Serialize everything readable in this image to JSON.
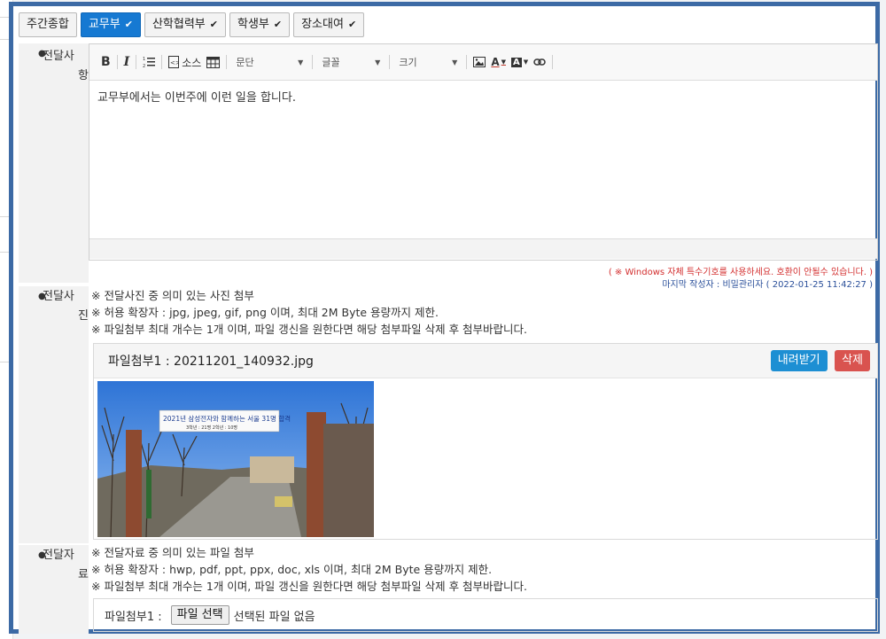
{
  "tabs": [
    {
      "label": "주간종합",
      "check": false,
      "active": false
    },
    {
      "label": "교무부",
      "check": true,
      "active": true
    },
    {
      "label": "산학협력부",
      "check": true,
      "active": false
    },
    {
      "label": "학생부",
      "check": true,
      "active": false
    },
    {
      "label": "장소대여",
      "check": true,
      "active": false
    }
  ],
  "check_glyph": "✔",
  "fields": {
    "message": {
      "label_a": "전달사",
      "label_b": "항"
    },
    "photo": {
      "label_a": "전달사",
      "label_b": "진"
    },
    "file": {
      "label_a": "전달자",
      "label_b": "료"
    }
  },
  "editor": {
    "toolbar": {
      "bold": "B",
      "italic": "I",
      "source": "소스",
      "paragraph": "문단",
      "font": "글꼴",
      "size": "크기",
      "text_color": "A",
      "bg_color": "A"
    },
    "content": "교무부에서는 이번주에 이런 일을 합니다."
  },
  "notes": {
    "warning": "( ※ Windows 자체 특수기호를 사용하세요. 호환이 안될수 있습니다. )",
    "last_author": "마지막 작성자 : 비밀관리자 ( 2022-01-25 11:42:27 )"
  },
  "photo_hints": [
    "※ 전달사진 중 의미 있는 사진 첨부",
    "※ 허용 확장자 : jpg, jpeg, gif, png 이며, 최대 2M Byte 용량까지 제한.",
    "※ 파일첨부 최대 개수는 1개 이며, 파일 갱신을 원한다면 해당 첨부파일 삭제 후 첨부바랍니다."
  ],
  "photo_attachment": {
    "title": "파일첨부1 : 20211201_140932.jpg",
    "download_label": "내려받기",
    "delete_label": "삭제",
    "banner_main": "2021년 삼성전자와 함께하는 서울 31명 합격",
    "banner_sub": "3학년 : 21명   2학년 : 10명"
  },
  "file_hints": [
    "※ 전달자료 중 의미 있는 파일 첨부",
    "※ 허용 확장자 : hwp, pdf, ppt, ppx, doc, xls 이며, 최대 2M Byte 용량까지 제한.",
    "※ 파일첨부 최대 개수는 1개 이며, 파일 갱신을 원한다면 해당 첨부파일 삭제 후 첨부바랍니다."
  ],
  "file_input": {
    "label": "파일첨부1 :",
    "button": "파일 선택",
    "status": "선택된 파일 없음"
  },
  "colors": {
    "accent": "#1679d2",
    "frame": "#3c6aa5",
    "warning": "#d32f2f",
    "author": "#2a4f9a"
  }
}
